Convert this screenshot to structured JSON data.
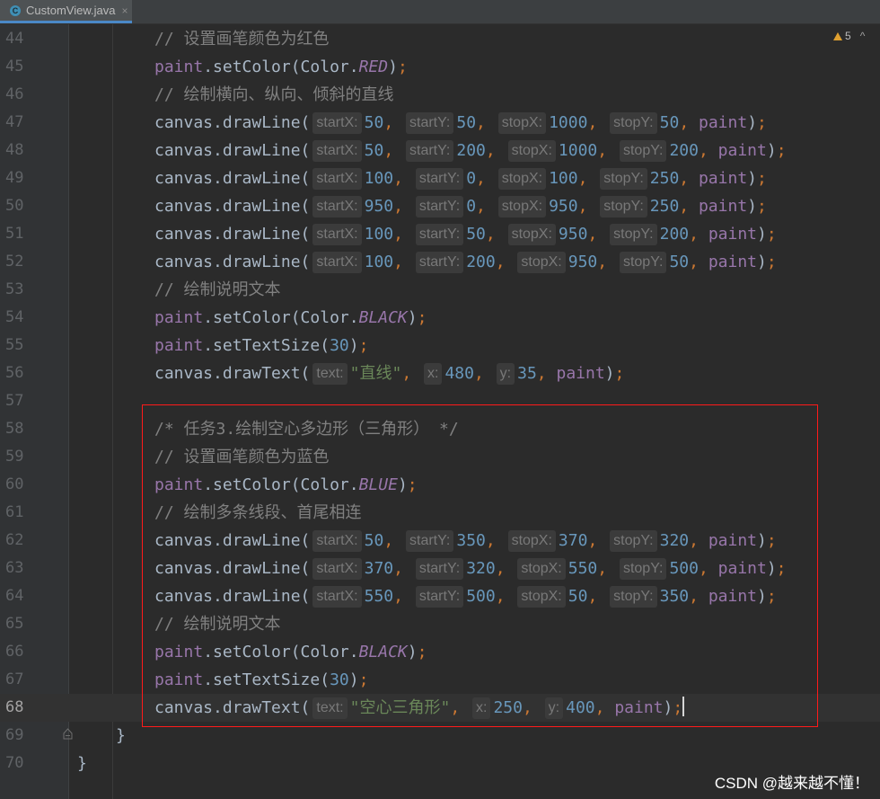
{
  "tab": {
    "icon": "java-class-icon",
    "icon_letter": "C",
    "filename": "CustomView.java",
    "close": "×"
  },
  "inspection": {
    "warnings": "5",
    "chevron": "^"
  },
  "watermark": "CSDN @越来越不懂！",
  "lines": [
    {
      "no": "44",
      "tokens": [
        {
          "t": "cm",
          "v": "// 设置画笔颜色为红色"
        }
      ]
    },
    {
      "no": "45",
      "tokens": [
        {
          "t": "var",
          "v": "paint"
        },
        {
          "t": "plain",
          "v": ".setColor(Color."
        },
        {
          "t": "const",
          "v": "RED"
        },
        {
          "t": "plain",
          "v": ")"
        },
        {
          "t": "punc",
          "v": ";"
        }
      ]
    },
    {
      "no": "46",
      "tokens": [
        {
          "t": "cm",
          "v": "// 绘制横向、纵向、倾斜的直线"
        }
      ]
    },
    {
      "no": "47",
      "tokens": [
        {
          "t": "plain",
          "v": "canvas.drawLine("
        },
        {
          "t": "hint",
          "v": "startX:"
        },
        {
          "t": "num",
          "v": "50"
        },
        {
          "t": "punc",
          "v": ", "
        },
        {
          "t": "hint",
          "v": "startY:"
        },
        {
          "t": "num",
          "v": "50"
        },
        {
          "t": "punc",
          "v": ", "
        },
        {
          "t": "hint",
          "v": "stopX:"
        },
        {
          "t": "num",
          "v": "1000"
        },
        {
          "t": "punc",
          "v": ", "
        },
        {
          "t": "hint",
          "v": "stopY:"
        },
        {
          "t": "num",
          "v": "50"
        },
        {
          "t": "punc",
          "v": ", "
        },
        {
          "t": "var",
          "v": "paint"
        },
        {
          "t": "plain",
          "v": ")"
        },
        {
          "t": "punc",
          "v": ";"
        }
      ]
    },
    {
      "no": "48",
      "tokens": [
        {
          "t": "plain",
          "v": "canvas.drawLine("
        },
        {
          "t": "hint",
          "v": "startX:"
        },
        {
          "t": "num",
          "v": "50"
        },
        {
          "t": "punc",
          "v": ", "
        },
        {
          "t": "hint",
          "v": "startY:"
        },
        {
          "t": "num",
          "v": "200"
        },
        {
          "t": "punc",
          "v": ", "
        },
        {
          "t": "hint",
          "v": "stopX:"
        },
        {
          "t": "num",
          "v": "1000"
        },
        {
          "t": "punc",
          "v": ", "
        },
        {
          "t": "hint",
          "v": "stopY:"
        },
        {
          "t": "num",
          "v": "200"
        },
        {
          "t": "punc",
          "v": ", "
        },
        {
          "t": "var",
          "v": "paint"
        },
        {
          "t": "plain",
          "v": ")"
        },
        {
          "t": "punc",
          "v": ";"
        }
      ]
    },
    {
      "no": "49",
      "tokens": [
        {
          "t": "plain",
          "v": "canvas.drawLine("
        },
        {
          "t": "hint",
          "v": "startX:"
        },
        {
          "t": "num",
          "v": "100"
        },
        {
          "t": "punc",
          "v": ", "
        },
        {
          "t": "hint",
          "v": "startY:"
        },
        {
          "t": "num",
          "v": "0"
        },
        {
          "t": "punc",
          "v": ", "
        },
        {
          "t": "hint",
          "v": "stopX:"
        },
        {
          "t": "num",
          "v": "100"
        },
        {
          "t": "punc",
          "v": ", "
        },
        {
          "t": "hint",
          "v": "stopY:"
        },
        {
          "t": "num",
          "v": "250"
        },
        {
          "t": "punc",
          "v": ", "
        },
        {
          "t": "var",
          "v": "paint"
        },
        {
          "t": "plain",
          "v": ")"
        },
        {
          "t": "punc",
          "v": ";"
        }
      ]
    },
    {
      "no": "50",
      "tokens": [
        {
          "t": "plain",
          "v": "canvas.drawLine("
        },
        {
          "t": "hint",
          "v": "startX:"
        },
        {
          "t": "num",
          "v": "950"
        },
        {
          "t": "punc",
          "v": ", "
        },
        {
          "t": "hint",
          "v": "startY:"
        },
        {
          "t": "num",
          "v": "0"
        },
        {
          "t": "punc",
          "v": ", "
        },
        {
          "t": "hint",
          "v": "stopX:"
        },
        {
          "t": "num",
          "v": "950"
        },
        {
          "t": "punc",
          "v": ", "
        },
        {
          "t": "hint",
          "v": "stopY:"
        },
        {
          "t": "num",
          "v": "250"
        },
        {
          "t": "punc",
          "v": ", "
        },
        {
          "t": "var",
          "v": "paint"
        },
        {
          "t": "plain",
          "v": ")"
        },
        {
          "t": "punc",
          "v": ";"
        }
      ]
    },
    {
      "no": "51",
      "tokens": [
        {
          "t": "plain",
          "v": "canvas.drawLine("
        },
        {
          "t": "hint",
          "v": "startX:"
        },
        {
          "t": "num",
          "v": "100"
        },
        {
          "t": "punc",
          "v": ", "
        },
        {
          "t": "hint",
          "v": "startY:"
        },
        {
          "t": "num",
          "v": "50"
        },
        {
          "t": "punc",
          "v": ", "
        },
        {
          "t": "hint",
          "v": "stopX:"
        },
        {
          "t": "num",
          "v": "950"
        },
        {
          "t": "punc",
          "v": ", "
        },
        {
          "t": "hint",
          "v": "stopY:"
        },
        {
          "t": "num",
          "v": "200"
        },
        {
          "t": "punc",
          "v": ", "
        },
        {
          "t": "var",
          "v": "paint"
        },
        {
          "t": "plain",
          "v": ")"
        },
        {
          "t": "punc",
          "v": ";"
        }
      ]
    },
    {
      "no": "52",
      "tokens": [
        {
          "t": "plain",
          "v": "canvas.drawLine("
        },
        {
          "t": "hint",
          "v": "startX:"
        },
        {
          "t": "num",
          "v": "100"
        },
        {
          "t": "punc",
          "v": ", "
        },
        {
          "t": "hint",
          "v": "startY:"
        },
        {
          "t": "num",
          "v": "200"
        },
        {
          "t": "punc",
          "v": ", "
        },
        {
          "t": "hint",
          "v": "stopX:"
        },
        {
          "t": "num",
          "v": "950"
        },
        {
          "t": "punc",
          "v": ", "
        },
        {
          "t": "hint",
          "v": "stopY:"
        },
        {
          "t": "num",
          "v": "50"
        },
        {
          "t": "punc",
          "v": ", "
        },
        {
          "t": "var",
          "v": "paint"
        },
        {
          "t": "plain",
          "v": ")"
        },
        {
          "t": "punc",
          "v": ";"
        }
      ]
    },
    {
      "no": "53",
      "tokens": [
        {
          "t": "cm",
          "v": "// 绘制说明文本"
        }
      ]
    },
    {
      "no": "54",
      "tokens": [
        {
          "t": "var",
          "v": "paint"
        },
        {
          "t": "plain",
          "v": ".setColor(Color."
        },
        {
          "t": "const",
          "v": "BLACK"
        },
        {
          "t": "plain",
          "v": ")"
        },
        {
          "t": "punc",
          "v": ";"
        }
      ]
    },
    {
      "no": "55",
      "tokens": [
        {
          "t": "var",
          "v": "paint"
        },
        {
          "t": "plain",
          "v": ".setTextSize("
        },
        {
          "t": "num",
          "v": "30"
        },
        {
          "t": "plain",
          "v": ")"
        },
        {
          "t": "punc",
          "v": ";"
        }
      ]
    },
    {
      "no": "56",
      "tokens": [
        {
          "t": "plain",
          "v": "canvas.drawText("
        },
        {
          "t": "hint",
          "v": "text:"
        },
        {
          "t": "str",
          "v": "\"直线\""
        },
        {
          "t": "punc",
          "v": ", "
        },
        {
          "t": "hint",
          "v": "x:"
        },
        {
          "t": "num",
          "v": "480"
        },
        {
          "t": "punc",
          "v": ", "
        },
        {
          "t": "hint",
          "v": "y:"
        },
        {
          "t": "num",
          "v": "35"
        },
        {
          "t": "punc",
          "v": ", "
        },
        {
          "t": "var",
          "v": "paint"
        },
        {
          "t": "plain",
          "v": ")"
        },
        {
          "t": "punc",
          "v": ";"
        }
      ]
    },
    {
      "no": "57",
      "tokens": []
    },
    {
      "no": "58",
      "tokens": [
        {
          "t": "cm",
          "v": "/* 任务3.绘制空心多边形（三角形） */"
        }
      ]
    },
    {
      "no": "59",
      "tokens": [
        {
          "t": "cm",
          "v": "// 设置画笔颜色为蓝色"
        }
      ]
    },
    {
      "no": "60",
      "tokens": [
        {
          "t": "var",
          "v": "paint"
        },
        {
          "t": "plain",
          "v": ".setColor(Color."
        },
        {
          "t": "const",
          "v": "BLUE"
        },
        {
          "t": "plain",
          "v": ")"
        },
        {
          "t": "punc",
          "v": ";"
        }
      ]
    },
    {
      "no": "61",
      "tokens": [
        {
          "t": "cm",
          "v": "// 绘制多条线段、首尾相连"
        }
      ]
    },
    {
      "no": "62",
      "tokens": [
        {
          "t": "plain",
          "v": "canvas.drawLine("
        },
        {
          "t": "hint",
          "v": "startX:"
        },
        {
          "t": "num",
          "v": "50"
        },
        {
          "t": "punc",
          "v": ", "
        },
        {
          "t": "hint",
          "v": "startY:"
        },
        {
          "t": "num",
          "v": "350"
        },
        {
          "t": "punc",
          "v": ", "
        },
        {
          "t": "hint",
          "v": "stopX:"
        },
        {
          "t": "num",
          "v": "370"
        },
        {
          "t": "punc",
          "v": ", "
        },
        {
          "t": "hint",
          "v": "stopY:"
        },
        {
          "t": "num",
          "v": "320"
        },
        {
          "t": "punc",
          "v": ", "
        },
        {
          "t": "var",
          "v": "paint"
        },
        {
          "t": "plain",
          "v": ")"
        },
        {
          "t": "punc",
          "v": ";"
        }
      ]
    },
    {
      "no": "63",
      "tokens": [
        {
          "t": "plain",
          "v": "canvas.drawLine("
        },
        {
          "t": "hint",
          "v": "startX:"
        },
        {
          "t": "num",
          "v": "370"
        },
        {
          "t": "punc",
          "v": ", "
        },
        {
          "t": "hint",
          "v": "startY:"
        },
        {
          "t": "num",
          "v": "320"
        },
        {
          "t": "punc",
          "v": ", "
        },
        {
          "t": "hint",
          "v": "stopX:"
        },
        {
          "t": "num",
          "v": "550"
        },
        {
          "t": "punc",
          "v": ", "
        },
        {
          "t": "hint",
          "v": "stopY:"
        },
        {
          "t": "num",
          "v": "500"
        },
        {
          "t": "punc",
          "v": ", "
        },
        {
          "t": "var",
          "v": "paint"
        },
        {
          "t": "plain",
          "v": ")"
        },
        {
          "t": "punc",
          "v": ";"
        }
      ]
    },
    {
      "no": "64",
      "tokens": [
        {
          "t": "plain",
          "v": "canvas.drawLine("
        },
        {
          "t": "hint",
          "v": "startX:"
        },
        {
          "t": "num",
          "v": "550"
        },
        {
          "t": "punc",
          "v": ", "
        },
        {
          "t": "hint",
          "v": "startY:"
        },
        {
          "t": "num",
          "v": "500"
        },
        {
          "t": "punc",
          "v": ", "
        },
        {
          "t": "hint",
          "v": "stopX:"
        },
        {
          "t": "num",
          "v": "50"
        },
        {
          "t": "punc",
          "v": ", "
        },
        {
          "t": "hint",
          "v": "stopY:"
        },
        {
          "t": "num",
          "v": "350"
        },
        {
          "t": "punc",
          "v": ", "
        },
        {
          "t": "var",
          "v": "paint"
        },
        {
          "t": "plain",
          "v": ")"
        },
        {
          "t": "punc",
          "v": ";"
        }
      ]
    },
    {
      "no": "65",
      "tokens": [
        {
          "t": "cm",
          "v": "// 绘制说明文本"
        }
      ]
    },
    {
      "no": "66",
      "tokens": [
        {
          "t": "var",
          "v": "paint"
        },
        {
          "t": "plain",
          "v": ".setColor(Color."
        },
        {
          "t": "const",
          "v": "BLACK"
        },
        {
          "t": "plain",
          "v": ")"
        },
        {
          "t": "punc",
          "v": ";"
        }
      ]
    },
    {
      "no": "67",
      "tokens": [
        {
          "t": "var",
          "v": "paint"
        },
        {
          "t": "plain",
          "v": ".setTextSize("
        },
        {
          "t": "num",
          "v": "30"
        },
        {
          "t": "plain",
          "v": ")"
        },
        {
          "t": "punc",
          "v": ";"
        }
      ]
    },
    {
      "no": "68",
      "current": true,
      "tokens": [
        {
          "t": "plain",
          "v": "canvas.drawText("
        },
        {
          "t": "hint",
          "v": "text:"
        },
        {
          "t": "str",
          "v": "\"空心三角形\""
        },
        {
          "t": "punc",
          "v": ", "
        },
        {
          "t": "hint",
          "v": "x:"
        },
        {
          "t": "num",
          "v": "250"
        },
        {
          "t": "punc",
          "v": ", "
        },
        {
          "t": "hint",
          "v": "y:"
        },
        {
          "t": "num",
          "v": "400"
        },
        {
          "t": "punc",
          "v": ", "
        },
        {
          "t": "var",
          "v": "paint"
        },
        {
          "t": "plain",
          "v": ")"
        },
        {
          "t": "punc",
          "v": ";"
        },
        {
          "t": "caret",
          "v": ""
        }
      ]
    },
    {
      "no": "69",
      "indent": 1,
      "tokens": [
        {
          "t": "plain",
          "v": "}"
        }
      ]
    },
    {
      "no": "70",
      "indent": 0,
      "tokens": [
        {
          "t": "plain",
          "v": "}"
        }
      ]
    }
  ],
  "colors": {
    "background": "#2b2b2b",
    "gutter": "#313335",
    "comment": "#808080",
    "field": "#9876aa",
    "number": "#6897bb",
    "string": "#6a8759",
    "keyword_punct": "#cc7832",
    "highlight_box": "#ff1a1a"
  }
}
